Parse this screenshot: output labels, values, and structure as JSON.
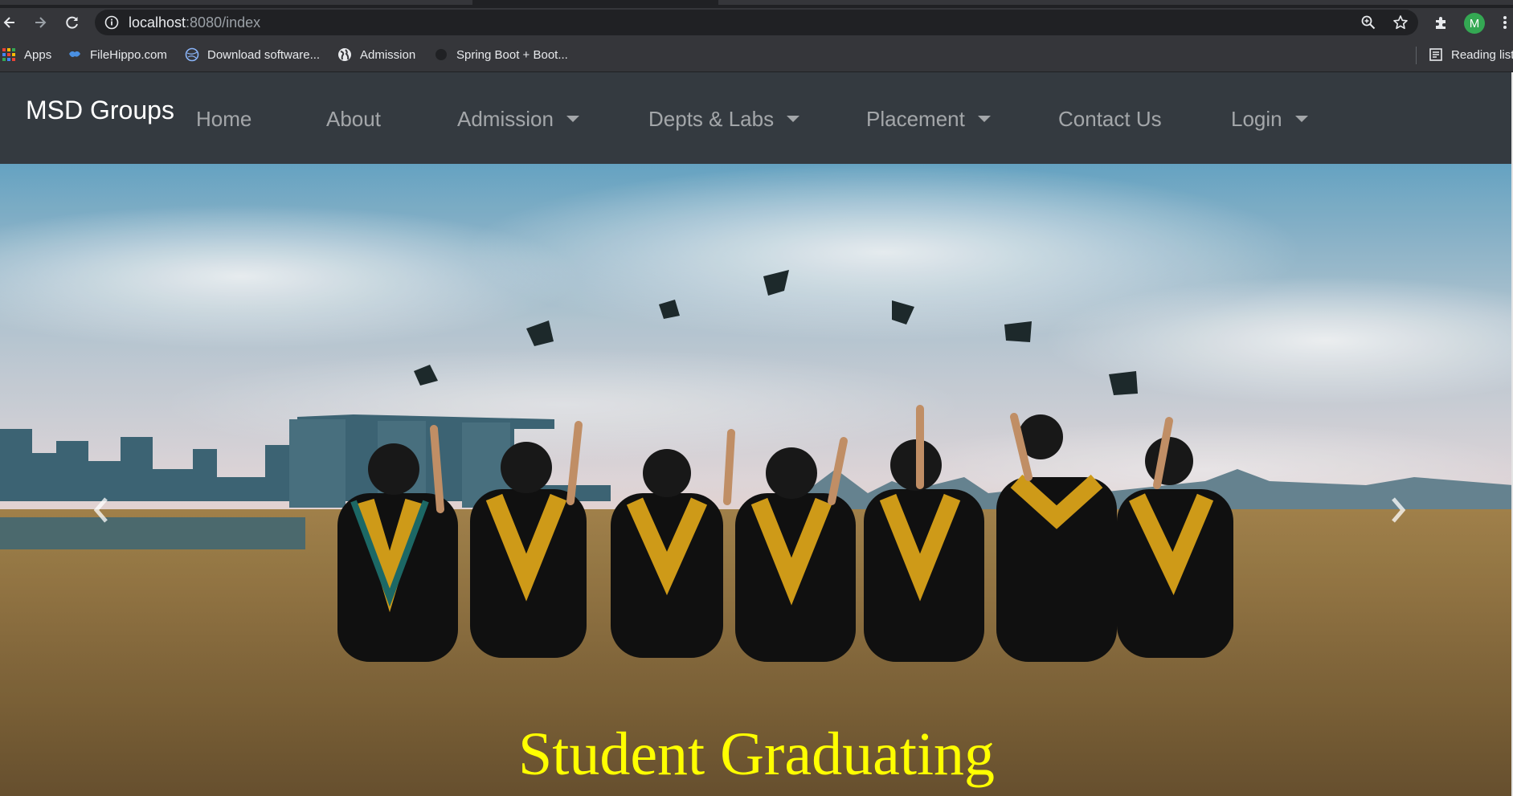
{
  "browser": {
    "url_host": "localhost",
    "url_path": ":8080/index",
    "profile_initial": "M",
    "bookmarks": {
      "apps": "Apps",
      "filehippo": "FileHippo.com",
      "download": "Download software...",
      "admission": "Admission",
      "springboot": "Spring Boot + Boot...",
      "reading_list": "Reading list"
    }
  },
  "navbar": {
    "brand": "MSD Groups",
    "links": {
      "home": "Home",
      "about": "About",
      "admission": "Admission",
      "depts": "Depts & Labs",
      "placement": "Placement",
      "contact": "Contact Us",
      "login": "Login"
    },
    "colors": {
      "background": "#343a40",
      "link": "rgba(255,255,255,0.55)",
      "brand": "#ffffff"
    }
  },
  "carousel": {
    "caption": "Student Graduating",
    "caption_color": "#ffff00"
  },
  "icons": [
    "back-icon",
    "forward-icon",
    "reload-icon",
    "info-icon",
    "zoom-icon",
    "star-icon",
    "extensions-icon",
    "menu-icon",
    "apps-grid-icon",
    "reading-list-icon",
    "prev-icon",
    "next-icon"
  ]
}
